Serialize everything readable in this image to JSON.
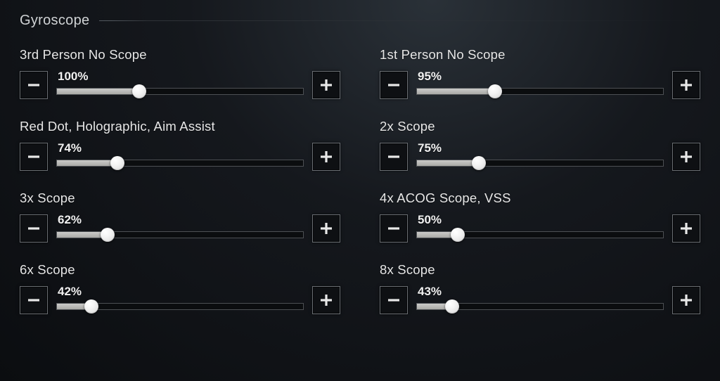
{
  "section_title": "Gyroscope",
  "value_suffix": "%",
  "slider_max": 300,
  "settings": [
    {
      "id": "tpp-no-scope",
      "label": "3rd Person No Scope",
      "value": 100
    },
    {
      "id": "fpp-no-scope",
      "label": "1st Person No Scope",
      "value": 95
    },
    {
      "id": "reddot-holo",
      "label": "Red Dot, Holographic, Aim Assist",
      "value": 74
    },
    {
      "id": "scope-2x",
      "label": "2x Scope",
      "value": 75
    },
    {
      "id": "scope-3x",
      "label": "3x Scope",
      "value": 62
    },
    {
      "id": "scope-4x-vss",
      "label": "4x ACOG Scope, VSS",
      "value": 50
    },
    {
      "id": "scope-6x",
      "label": "6x Scope",
      "value": 42
    },
    {
      "id": "scope-8x",
      "label": "8x Scope",
      "value": 43
    }
  ]
}
